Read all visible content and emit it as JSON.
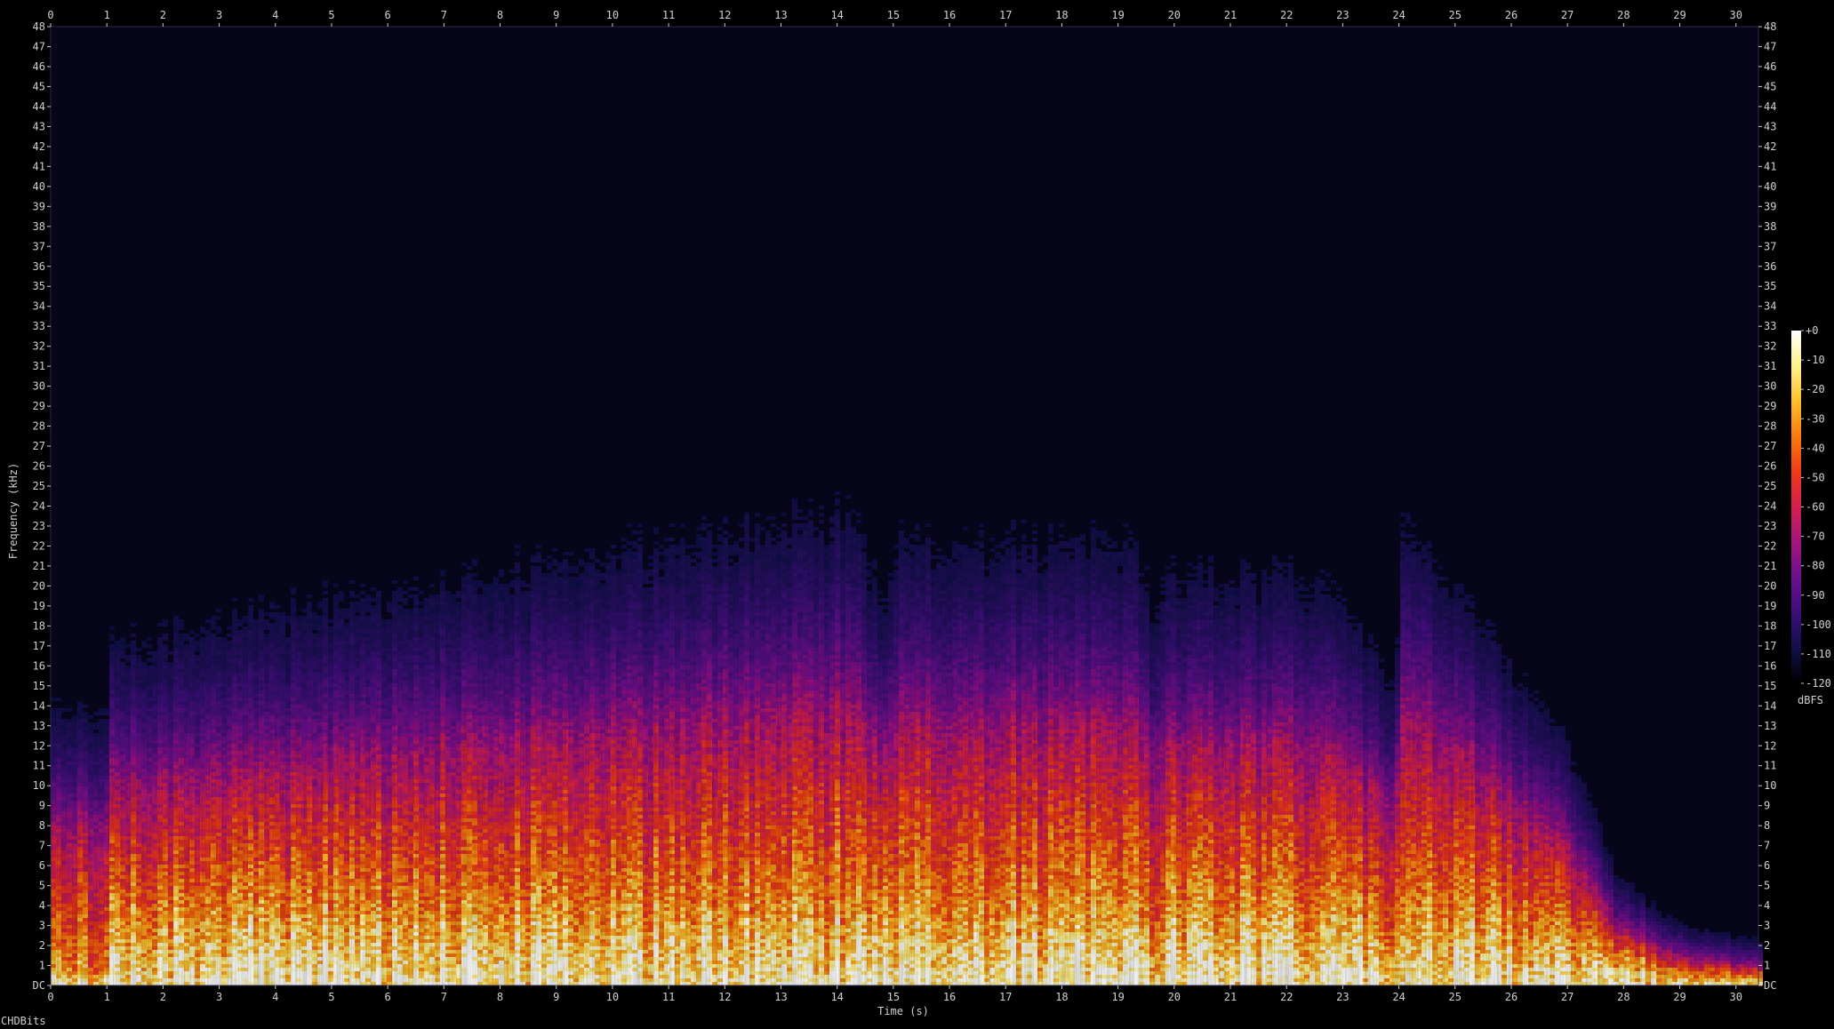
{
  "chart_data": {
    "type": "heatmap",
    "title": "",
    "xlabel": "Time (s)",
    "ylabel": "Frequency (kHz)",
    "xlim": [
      0,
      30.4
    ],
    "ylim": [
      0,
      48
    ],
    "x_ticks": [
      "0",
      "1",
      "2",
      "3",
      "4",
      "5",
      "6",
      "7",
      "8",
      "9",
      "10",
      "11",
      "12",
      "13",
      "14",
      "15",
      "16",
      "17",
      "18",
      "19",
      "20",
      "21",
      "22",
      "23",
      "24",
      "25",
      "26",
      "27",
      "28",
      "29",
      "30"
    ],
    "y_ticks": [
      "DC",
      "1",
      "2",
      "3",
      "4",
      "5",
      "6",
      "7",
      "8",
      "9",
      "10",
      "11",
      "12",
      "13",
      "14",
      "15",
      "16",
      "17",
      "18",
      "19",
      "20",
      "21",
      "22",
      "23",
      "24",
      "25",
      "26",
      "27",
      "28",
      "29",
      "30",
      "31",
      "32",
      "33",
      "34",
      "35",
      "36",
      "37",
      "38",
      "39",
      "40",
      "41",
      "42",
      "43",
      "44",
      "45",
      "46",
      "47",
      "48"
    ],
    "colorbar": {
      "unit": "dBFS",
      "range": [
        -120,
        0
      ],
      "ticks": [
        "+0",
        "-10",
        "-20",
        "-30",
        "-40",
        "-50",
        "-60",
        "-70",
        "-80",
        "-90",
        "-100",
        "-110",
        "-120"
      ],
      "colors": [
        "#000000",
        "#12104a",
        "#3c0e7a",
        "#6d0f8e",
        "#a4157f",
        "#d41f4f",
        "#f03a17",
        "#fb7b0c",
        "#ffbf2a",
        "#fff28a",
        "#ffffff"
      ]
    },
    "energy_envelope": {
      "description_times_s": [
        0,
        0.95,
        1,
        14.2,
        14.8,
        15.0,
        19.2,
        19.6,
        19.7,
        22.5,
        23.9,
        24.0,
        27.0,
        27.8,
        29,
        30.4
      ],
      "upper_bright_khz": [
        1,
        1,
        4,
        4.5,
        4,
        4.5,
        4.5,
        3,
        4.5,
        4,
        3,
        5,
        3,
        1.5,
        0.8,
        0.5
      ],
      "upper_visible_khz": [
        8,
        8,
        10,
        14,
        11,
        13,
        13,
        11,
        12,
        12,
        9,
        14,
        7,
        3,
        1.5,
        1
      ]
    }
  },
  "footer": {
    "label": "CHDBits"
  }
}
